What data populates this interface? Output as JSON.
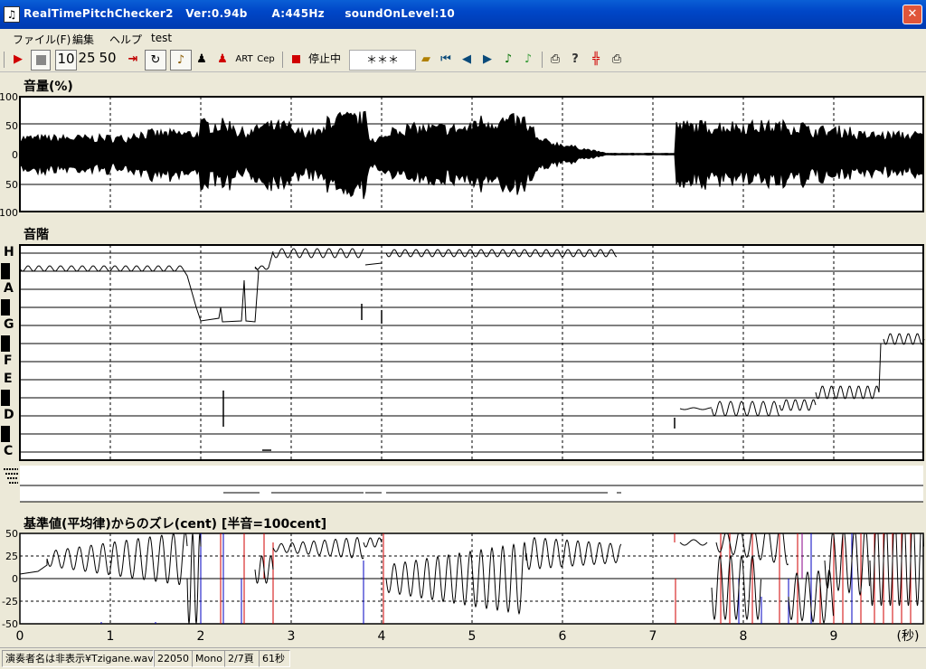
{
  "window": {
    "title": "RealTimePitchChecker2   Ver:0.94b      A:445Hz     soundOnLevel:10",
    "close_glyph": "✕"
  },
  "menu": [
    "ファイル(F)",
    "編集",
    "ヘルプ",
    "test"
  ],
  "toolbar": {
    "speed_values": [
      "10",
      "25",
      "50"
    ],
    "art_label": "ART",
    "cep_label": "Cep",
    "stop_status": "停止中",
    "note_display": "＊＊＊"
  },
  "panels": {
    "volume": {
      "title": "音量(%)",
      "ticks": [
        "100",
        "50",
        "0",
        "50",
        "100"
      ]
    },
    "scale": {
      "title": "音階",
      "notes": [
        "H",
        "A",
        "G",
        "F",
        "E",
        "D",
        "C"
      ]
    },
    "deviation": {
      "title": "基準値(平均律)からのズレ(cent) [半音=100cent]",
      "ticks": [
        "50",
        "25",
        "0",
        "-25",
        "-50"
      ]
    },
    "time_axis": {
      "ticks": [
        "0",
        "1",
        "2",
        "3",
        "4",
        "5",
        "6",
        "7",
        "8",
        "9"
      ],
      "unit": "(秒)"
    }
  },
  "status": [
    "演奏者名は非表示¥Tzigane.wav",
    "22050",
    "Mono",
    "2/7頁",
    "61秒"
  ],
  "colors": {
    "titlebar": "#0046c7",
    "trace": "#000000",
    "deviation_blue": "#0000c0",
    "deviation_red": "#d00000",
    "deviation_purple": "#880088"
  }
}
